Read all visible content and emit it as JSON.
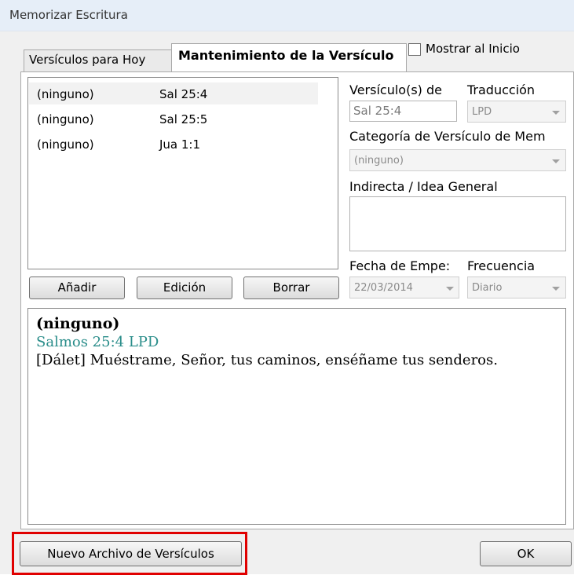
{
  "window": {
    "title": "Memorizar Escritura"
  },
  "tabs": [
    {
      "label": "Versículos para Hoy"
    },
    {
      "label": "Mantenimiento de la Versículo"
    }
  ],
  "show_at_start": {
    "label": "Mostrar al Inicio",
    "checked": false
  },
  "verse_list": {
    "rows": [
      {
        "category": "(ninguno)",
        "reference": "Sal 25:4",
        "selected": true
      },
      {
        "category": "(ninguno)",
        "reference": "Sal 25:5",
        "selected": false
      },
      {
        "category": "(ninguno)",
        "reference": "Jua 1:1",
        "selected": false
      }
    ]
  },
  "list_buttons": {
    "add": "Añadir",
    "edit": "Edición",
    "delete": "Borrar"
  },
  "details": {
    "verse_label": "Versículo(s) de",
    "verse_value": "Sal 25:4",
    "translation_label": "Traducción",
    "translation_value": "LPD",
    "category_label": "Categoría de Versículo de Mem",
    "category_value": "(ninguno)",
    "hint_label": "Indirecta / Idea General",
    "hint_value": "",
    "start_date_label": "Fecha de Empe:",
    "start_date_value": "22/03/2014",
    "frequency_label": "Frecuencia",
    "frequency_value": "Diario"
  },
  "preview": {
    "title": "(ninguno)",
    "reference": "Salmos 25:4 LPD",
    "text": "[Dálet] Muéstrame, Señor, tus caminos, enséñame tus senderos."
  },
  "footer": {
    "new_file_button": "Nuevo Archivo de Versículos",
    "ok_button": "OK"
  },
  "colors": {
    "highlight": "#e00000",
    "reference_text": "#2a8d8a"
  }
}
